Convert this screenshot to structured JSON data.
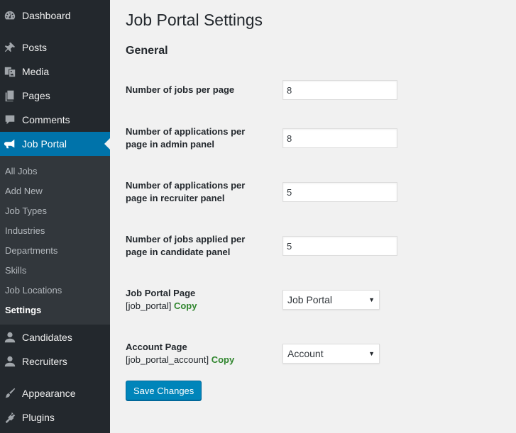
{
  "sidebar": {
    "menu": [
      {
        "label": "Dashboard",
        "icon": "dashboard-icon"
      },
      {
        "label": "Posts",
        "icon": "pin-icon"
      },
      {
        "label": "Media",
        "icon": "media-icon"
      },
      {
        "label": "Pages",
        "icon": "pages-icon"
      },
      {
        "label": "Comments",
        "icon": "comment-icon"
      },
      {
        "label": "Job Portal",
        "icon": "megaphone-icon"
      },
      {
        "label": "Candidates",
        "icon": "user-icon"
      },
      {
        "label": "Recruiters",
        "icon": "user-icon"
      },
      {
        "label": "Appearance",
        "icon": "brush-icon"
      },
      {
        "label": "Plugins",
        "icon": "plugin-icon"
      }
    ],
    "submenu": [
      "All Jobs",
      "Add New",
      "Job Types",
      "Industries",
      "Departments",
      "Skills",
      "Job Locations",
      "Settings"
    ]
  },
  "main": {
    "title": "Job Portal Settings",
    "section": "General",
    "fields": {
      "jobs_per_page": {
        "label": "Number of jobs per page",
        "value": "8"
      },
      "apps_admin": {
        "label1": "Number of applications per",
        "label2": "page in admin panel",
        "value": "8"
      },
      "apps_recruiter": {
        "label1": "Number of applications per",
        "label2": "page in recruiter panel",
        "value": "5"
      },
      "applied_candidate": {
        "label1": "Number of jobs applied per",
        "label2": "page in candidate panel",
        "value": "5"
      },
      "job_portal_page": {
        "label": "Job Portal Page",
        "shortcode": "[job_portal]",
        "copy": "Copy",
        "selected": "Job Portal"
      },
      "account_page": {
        "label": "Account Page",
        "shortcode": "[job_portal_account]",
        "copy": "Copy",
        "selected": "Account"
      }
    },
    "save_label": "Save Changes"
  },
  "colors": {
    "sidebar_bg": "#23282d",
    "submenu_bg": "#32373c",
    "accent": "#0073aa",
    "button": "#0085ba",
    "copy_link": "#31862f"
  }
}
